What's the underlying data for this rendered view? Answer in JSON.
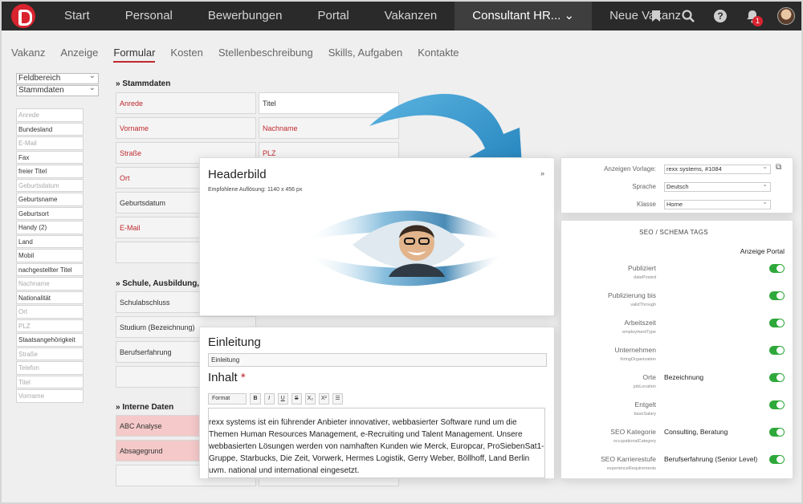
{
  "topnav": {
    "items": [
      "Start",
      "Personal",
      "Bewerbungen",
      "Portal",
      "Vakanzen"
    ],
    "active": "Consultant HR...",
    "extra": "Neue Vakanz",
    "notification_count": "1"
  },
  "subnav": {
    "tabs": [
      "Vakanz",
      "Anzeige",
      "Formular",
      "Kosten",
      "Stellenbeschreibung",
      "Skills, Aufgaben",
      "Kontakte"
    ]
  },
  "left": {
    "select1": "Feldbereich",
    "select2": "Stammdaten",
    "fields": [
      "Anrede",
      "Bundesland",
      "E-Mail",
      "Fax",
      "freier Titel",
      "Geburtsdatum",
      "Geburtsname",
      "Geburtsort",
      "Handy (2)",
      "Land",
      "Mobil",
      "nachgestellter Titel",
      "Nachname",
      "Nationalität",
      "Ort",
      "PLZ",
      "Staatsangehörigkeit",
      "Straße",
      "Telefon",
      "Titel",
      "Vorname"
    ]
  },
  "form": {
    "stammdaten_title": "» Stammdaten",
    "stammdaten": [
      "Anrede",
      "Titel",
      "Vorname",
      "Nachname",
      "Straße",
      "PLZ",
      "Ort",
      "",
      "Geburtsdatum",
      "",
      "E-Mail",
      ""
    ],
    "schule_title": "» Schule, Ausbildung, E",
    "schule": [
      "Schulabschluss",
      "Studium (Bezeichnung)",
      "Berufserfahrung"
    ],
    "intern_title": "» Interne Daten",
    "intern": [
      "ABC Analyse",
      "Absagegrund"
    ]
  },
  "headerbild": {
    "title": "Headerbild",
    "hint": "Empfohlene Auflösung: 1140 x 456 px"
  },
  "content": {
    "einleitung_label": "Einleitung",
    "einleitung_value": "Einleitung",
    "inhalt_label": "Inhalt",
    "required_mark": "*",
    "toolbar": [
      "Format",
      "B",
      "I",
      "U",
      "S",
      "X₂",
      "X²",
      "☰"
    ],
    "text": "rexx systems ist ein führender Anbieter innovativer, webbasierter Software rund um die Themen Human Resources Management, e-Recruiting und Talent Management. Unsere webbasierten Lösungen werden von namhaften Kunden wie Merck, Europcar, ProSiebenSat1-Gruppe, Starbucks, Die Zeit, Vorwerk, Hermes Logistik, Gerry Weber, Böllhoff, Land Berlin uvm. national und international eingesetzt."
  },
  "settings": {
    "vorlage_label": "Anzeigen Vorlage:",
    "vorlage": "rexx systems, #1084",
    "sprache_label": "Sprache",
    "sprache": "Deutsch",
    "klasse_label": "Klasse",
    "klasse": "Home"
  },
  "seo": {
    "title": "SEO / SCHEMA TAGS",
    "col": "Anzeige Portal",
    "rows": [
      {
        "label": "Publiziert",
        "sub": "datePosted",
        "value": ""
      },
      {
        "label": "Publizierung bis",
        "sub": "validThrough",
        "value": ""
      },
      {
        "label": "Arbeitszeit",
        "sub": "employmentType",
        "value": ""
      },
      {
        "label": "Unternehmen",
        "sub": "hiringOrganization",
        "value": ""
      },
      {
        "label": "Orte",
        "sub": "jobLocation",
        "value": "Bezeichnung"
      },
      {
        "label": "Entgelt",
        "sub": "baseSalary",
        "value": ""
      },
      {
        "label": "SEO Kategorie",
        "sub": "occupationalCategory",
        "value": "Consulting, Beratung"
      },
      {
        "label": "SEO Karrierestufe",
        "sub": "experienceRequirements",
        "value": "Berufserfahrung (Senior Level)"
      }
    ]
  },
  "colors": {
    "accent": "#c0292e",
    "toggle": "#2ea83a",
    "arrow": "#2a8fc7"
  }
}
